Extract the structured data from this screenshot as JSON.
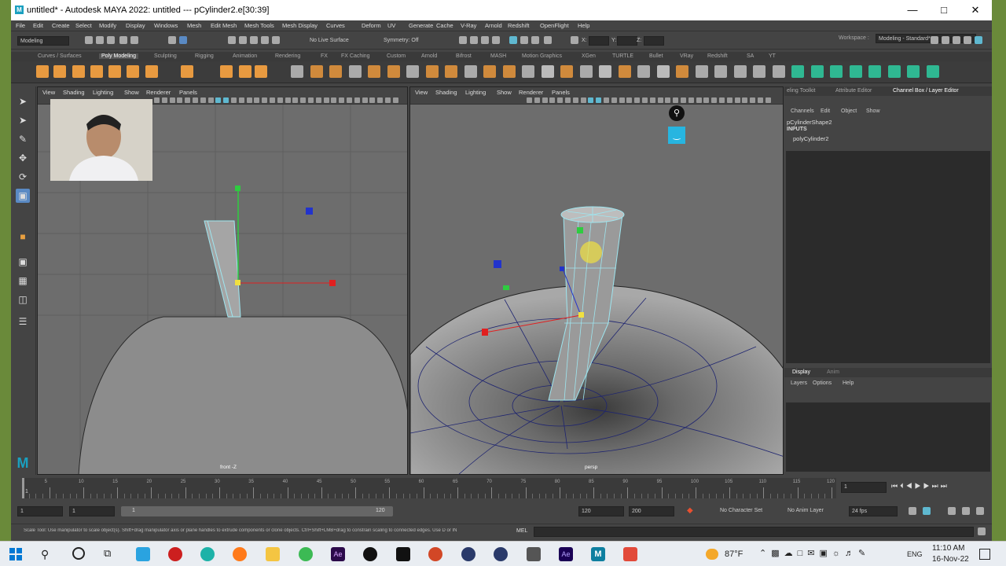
{
  "window": {
    "title": "untitled* - Autodesk MAYA 2022: untitled   ---   pCylinder2.e[30:39]",
    "logo": "M"
  },
  "menus": [
    "File",
    "Edit",
    "Create",
    "Select",
    "Modify",
    "Display",
    "Windows",
    "Mesh",
    "Edit Mesh",
    "Mesh Tools",
    "Mesh Display",
    "Curves",
    "Deform",
    "UV",
    "Generate",
    "Cache",
    "V-Ray",
    "Arnold",
    "Redshift",
    "OpenFlight",
    "Help"
  ],
  "workspace": {
    "label": "Workspace :",
    "value": "Modeling - Standard*"
  },
  "statusline": {
    "mode": "Modeling",
    "live_surface": "No Live Surface",
    "symmetry": "Symmetry: Off",
    "x": "X:",
    "y": "Y:",
    "z": "Z:"
  },
  "shelf_tabs": [
    "Curves / Surfaces",
    "Poly Modeling",
    "Sculpting",
    "Rigging",
    "Animation",
    "Rendering",
    "FX",
    "FX Caching",
    "Custom",
    "Arnold",
    "Bifrost",
    "MASH",
    "Motion Graphics",
    "XGen",
    "TURTLE",
    "Bullet",
    "VRay",
    "Redshift",
    "SA",
    "YT"
  ],
  "shelf_active": "Poly Modeling",
  "viewport_menu": [
    "View",
    "Shading",
    "Lighting",
    "Show",
    "Renderer",
    "Panels"
  ],
  "viewports": {
    "front_label": "front -Z",
    "persp_label": "persp"
  },
  "right_panel": {
    "tabs": [
      "eling Toolkit",
      "Attribute Editor",
      "Channel Box / Layer Editor"
    ],
    "channel_menu": [
      "Channels",
      "Edit",
      "Object",
      "Show"
    ],
    "shape_name": "pCylinderShape2",
    "inputs_label": "INPUTS",
    "input_node": "polyCylinder2",
    "layer_tabs": [
      "Display",
      "Anim"
    ],
    "layer_menu": [
      "Layers",
      "Options",
      "Help"
    ]
  },
  "timeline": {
    "ticks": [
      "5",
      "10",
      "15",
      "20",
      "25",
      "30",
      "35",
      "40",
      "45",
      "50",
      "55",
      "60",
      "65",
      "70",
      "75",
      "80",
      "85",
      "90",
      "95",
      "100",
      "105",
      "110",
      "115",
      "120"
    ],
    "start_marker": "1",
    "current_frame": "1"
  },
  "range": {
    "start": "1",
    "anim_start": "1",
    "playback_start": "1",
    "playback_end": "120",
    "end": "120",
    "anim_end": "200",
    "character_set": "No Character Set",
    "anim_layer": "No Anim Layer",
    "fps": "24 fps"
  },
  "cmdline": {
    "help": "Scale Tool: Use manipulator to scale object(s). Shift+drag manipulator axis or plane handles to extrude components or clone objects. Ctrl+Shift+LMB+drag to constrain scaling to connected edges. Use D or IN",
    "lang": "MEL"
  },
  "taskbar": {
    "temp": "87°F",
    "lang": "ENG",
    "time": "11:10 AM",
    "date": "16-Nov-22"
  }
}
